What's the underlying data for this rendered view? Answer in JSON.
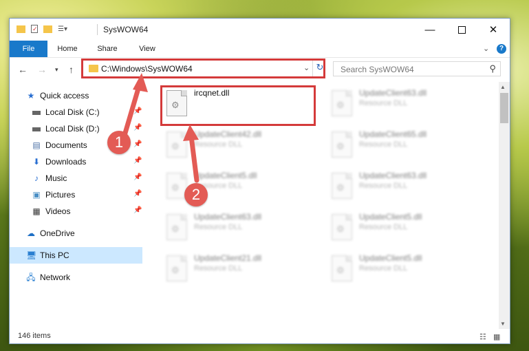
{
  "window": {
    "title": "SysWOW64"
  },
  "ribbon": {
    "tabs": [
      "File",
      "Home",
      "Share",
      "View"
    ]
  },
  "address": {
    "path": "C:\\Windows\\SysWOW64"
  },
  "search": {
    "placeholder": "Search SysWOW64"
  },
  "sidebar": {
    "quick_access": "Quick access",
    "items": [
      {
        "label": "Local Disk (C:)",
        "icon": "drive-icon"
      },
      {
        "label": "Local Disk (D:)",
        "icon": "drive-icon"
      },
      {
        "label": "Documents",
        "icon": "documents-icon"
      },
      {
        "label": "Downloads",
        "icon": "downloads-icon"
      },
      {
        "label": "Music",
        "icon": "music-icon"
      },
      {
        "label": "Pictures",
        "icon": "pictures-icon"
      },
      {
        "label": "Videos",
        "icon": "videos-icon"
      }
    ],
    "onedrive": "OneDrive",
    "this_pc": "This PC",
    "network": "Network"
  },
  "files": {
    "main": {
      "name": "ircqnet.dll"
    },
    "blurred": [
      {
        "name": "UpdateClient63.dll",
        "type": "Resource DLL"
      },
      {
        "name": "UpdateClient42.dll",
        "type": "Resource DLL"
      },
      {
        "name": "UpdateClient65.dll",
        "type": "Resource DLL"
      },
      {
        "name": "UpdateClient5.dll",
        "type": "Resource DLL"
      },
      {
        "name": "UpdateClient63.dll",
        "type": "Resource DLL"
      },
      {
        "name": "UpdateClient63.dll",
        "type": "Resource DLL"
      },
      {
        "name": "UpdateClient5.dll",
        "type": "Resource DLL"
      },
      {
        "name": "UpdateClient21.dll",
        "type": "Resource DLL"
      },
      {
        "name": "UpdateClient5.dll",
        "type": "Resource DLL"
      }
    ]
  },
  "status": {
    "items": "146 items"
  },
  "annotations": {
    "badge1": "1",
    "badge2": "2"
  },
  "colors": {
    "accent": "#1979ca",
    "highlight": "#d43a3a",
    "badge": "#e35b55"
  }
}
